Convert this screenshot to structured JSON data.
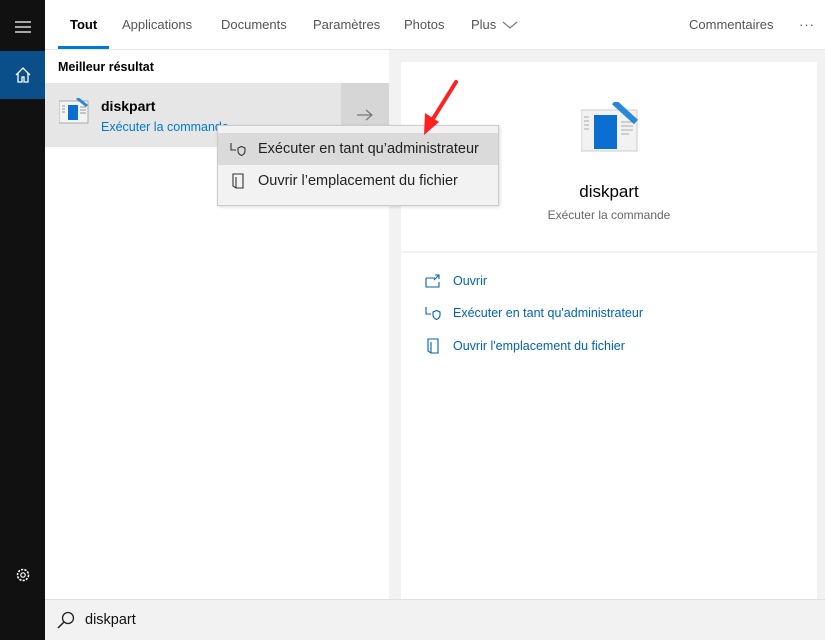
{
  "tabs": [
    {
      "label": "Tout",
      "active": true
    },
    {
      "label": "Applications"
    },
    {
      "label": "Documents"
    },
    {
      "label": "Paramètres"
    },
    {
      "label": "Photos"
    },
    {
      "label": "Plus"
    }
  ],
  "header": {
    "feedback": "Commentaires",
    "more": "···"
  },
  "best": {
    "heading": "Meilleur résultat",
    "name": "diskpart",
    "sub": "Exécuter la commande"
  },
  "context_menu": [
    {
      "label": "Exécuter en tant qu’administrateur",
      "icon": "shield-icon",
      "highlighted": true
    },
    {
      "label": "Ouvrir l’emplacement du fichier",
      "icon": "folder-location-icon"
    }
  ],
  "detail": {
    "name": "diskpart",
    "sub": "Exécuter la commande",
    "actions": [
      {
        "label": "Ouvrir",
        "icon": "open-icon"
      },
      {
        "label": "Exécuter en tant qu'administrateur",
        "icon": "shield-icon"
      },
      {
        "label": "Ouvrir l'emplacement du fichier",
        "icon": "folder-location-icon"
      }
    ]
  },
  "search": {
    "value": "diskpart"
  },
  "colors": {
    "accent": "#0078d7",
    "sidebar": "#111111",
    "home_selected": "#0a4f8a",
    "annotation_arrow": "#ff2020"
  }
}
